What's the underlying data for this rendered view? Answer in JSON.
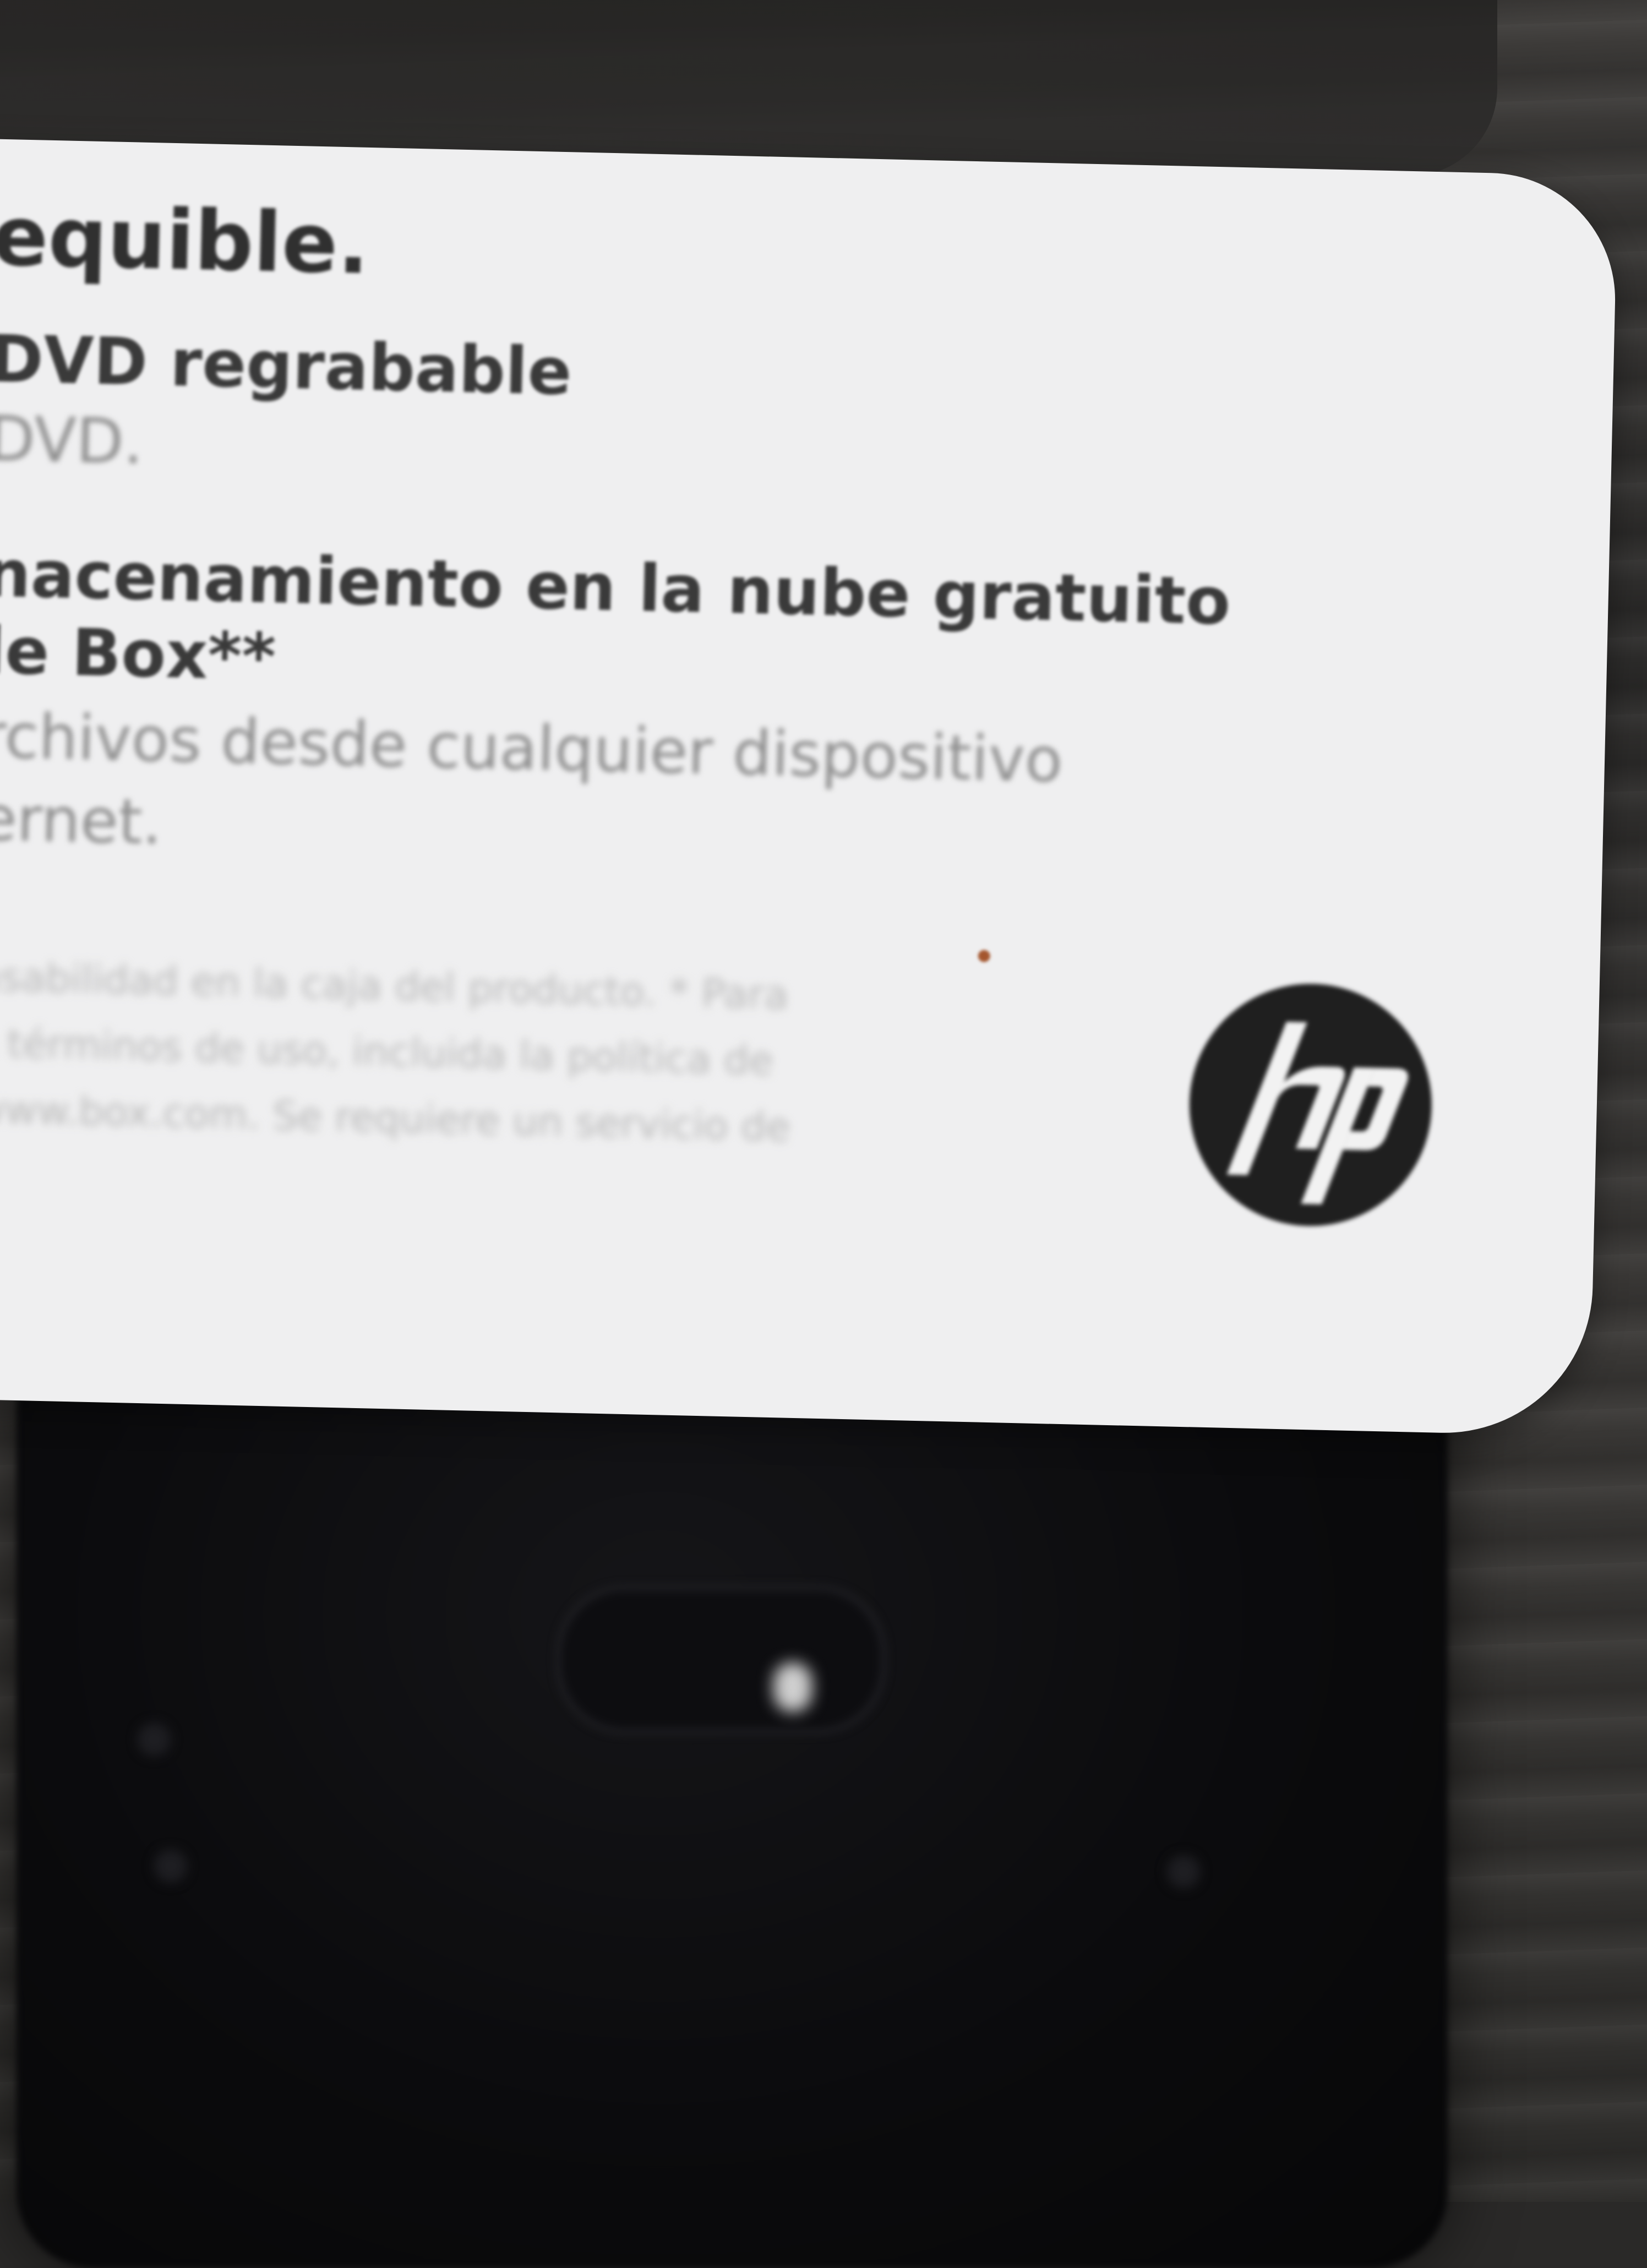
{
  "card": {
    "headline": "equible.",
    "feature1_title": "DVD regrabable",
    "feature1_sub": "DVD.",
    "feature2_title_line1": "nacenamiento en la nube gratuito",
    "feature2_title_line2": "le Box**",
    "feature2_sub_line1": "rchivos desde cualquier dispositivo",
    "feature2_sub_line2": "ernet.",
    "fine_print_line1": "nsabilidad en la caja del producto. * Para",
    "fine_print_line2": "s términos de uso, incluida la política de",
    "fine_print_line3": "www.box.com. Se requiere un servicio de"
  },
  "logo": {
    "name": "hp-logo",
    "lettering": "hp"
  },
  "colors": {
    "card": "#efeff0",
    "logo_disc": "#1f1f1f",
    "device": "#0b0b0d",
    "surface": "#2c2b2a"
  }
}
